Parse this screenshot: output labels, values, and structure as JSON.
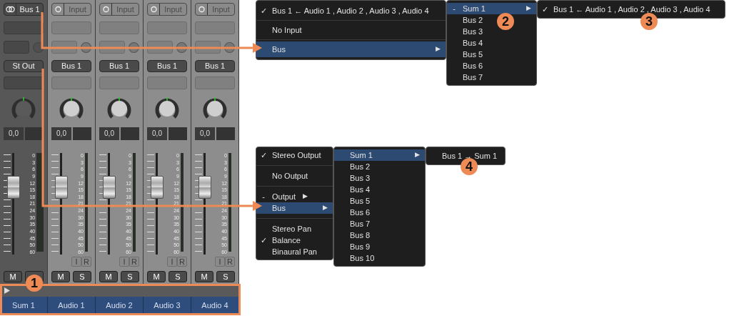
{
  "strips": [
    {
      "kind": "aux",
      "input": {
        "kind": "stereo",
        "label": "Bus 1",
        "assigned": true
      },
      "output": "St Out",
      "pan": "0,0",
      "level": 0.7,
      "scale": [
        "0",
        "3",
        "6",
        "9",
        "12",
        "15",
        "18",
        "21",
        "24",
        "30",
        "35",
        "40",
        "45",
        "50",
        "60"
      ],
      "mute": "M",
      "name": "Sum 1"
    },
    {
      "kind": "audio",
      "input": {
        "kind": "mono",
        "label": "Input",
        "assigned": false
      },
      "output": "Bus 1",
      "pan": "0,0",
      "level": 0.7,
      "scale": [
        "0",
        "3",
        "6",
        "9",
        "12",
        "15",
        "18",
        "21",
        "24",
        "30",
        "35",
        "40",
        "45",
        "50",
        "60"
      ],
      "ir": [
        "I",
        "R"
      ],
      "mute": "M",
      "solo": "S",
      "name": "Audio 1"
    },
    {
      "kind": "audio",
      "input": {
        "kind": "mono",
        "label": "Input",
        "assigned": false
      },
      "output": "Bus 1",
      "pan": "0,0",
      "level": 0.7,
      "scale": [
        "0",
        "3",
        "6",
        "9",
        "12",
        "15",
        "18",
        "21",
        "24",
        "30",
        "35",
        "40",
        "45",
        "50",
        "60"
      ],
      "ir": [
        "I",
        "R"
      ],
      "mute": "M",
      "solo": "S",
      "name": "Audio 2"
    },
    {
      "kind": "audio",
      "input": {
        "kind": "mono",
        "label": "Input",
        "assigned": false
      },
      "output": "Bus 1",
      "pan": "0,0",
      "level": 0.7,
      "scale": [
        "0",
        "3",
        "6",
        "9",
        "12",
        "15",
        "18",
        "21",
        "24",
        "30",
        "35",
        "40",
        "45",
        "50",
        "60"
      ],
      "ir": [
        "I",
        "R"
      ],
      "mute": "M",
      "solo": "S",
      "name": "Audio 3"
    },
    {
      "kind": "audio",
      "input": {
        "kind": "mono",
        "label": "Input",
        "assigned": false
      },
      "output": "Bus 1",
      "pan": "0,0",
      "level": 0.7,
      "scale": [
        "0",
        "3",
        "6",
        "9",
        "12",
        "15",
        "18",
        "21",
        "24",
        "30",
        "35",
        "40",
        "45",
        "50",
        "60"
      ],
      "ir": [
        "I",
        "R"
      ],
      "mute": "M",
      "solo": "S",
      "name": "Audio 4"
    }
  ],
  "menus": [
    {
      "items": [
        {
          "kind": "item",
          "mark": "✓",
          "label": "Bus 1 ← Audio 1 , Audio 2 , Audio 3 , Audio 4",
          "selected": false
        },
        {
          "kind": "separator"
        },
        {
          "kind": "item",
          "label": "No Input",
          "selected": false
        },
        {
          "kind": "separator"
        },
        {
          "kind": "item",
          "label": "Bus",
          "arrow": "▶",
          "selected": true
        }
      ]
    },
    {
      "items": [
        {
          "kind": "item",
          "mark": "-",
          "label": "Sum 1",
          "arrow": "▶",
          "selected": true
        },
        {
          "kind": "item",
          "label": "Bus 2",
          "selected": false
        },
        {
          "kind": "item",
          "label": "Bus 3",
          "selected": false
        },
        {
          "kind": "item",
          "label": "Bus 4",
          "selected": false
        },
        {
          "kind": "item",
          "label": "Bus 5",
          "selected": false
        },
        {
          "kind": "item",
          "label": "Bus 6",
          "selected": false
        },
        {
          "kind": "item",
          "label": "Bus 7",
          "selected": false
        }
      ]
    },
    {
      "items": [
        {
          "kind": "item",
          "mark": "✓",
          "label": "Bus 1 ← Audio 1 , Audio 2 , Audio 3 , Audio 4",
          "selected": false
        }
      ]
    },
    {
      "items": [
        {
          "kind": "item",
          "mark": "✓",
          "label": "Stereo Output",
          "selected": false
        },
        {
          "kind": "separator"
        },
        {
          "kind": "item",
          "label": "No Output",
          "selected": false
        },
        {
          "kind": "separator"
        },
        {
          "kind": "item",
          "mark": "-",
          "label": "Output",
          "arrow": "▶",
          "selected": false
        },
        {
          "kind": "item",
          "label": "Bus",
          "arrow": "▶",
          "selected": true
        },
        {
          "kind": "separator"
        },
        {
          "kind": "item",
          "label": "Stereo Pan",
          "selected": false
        },
        {
          "kind": "item",
          "mark": "✓",
          "label": "Balance",
          "selected": false
        },
        {
          "kind": "item",
          "label": "Binaural Pan",
          "selected": false
        }
      ]
    },
    {
      "items": [
        {
          "kind": "item",
          "label": "Sum 1",
          "arrow": "▶",
          "selected": true
        },
        {
          "kind": "item",
          "label": "Bus 2",
          "selected": false
        },
        {
          "kind": "item",
          "label": "Bus 3",
          "selected": false
        },
        {
          "kind": "item",
          "label": "Bus 4",
          "selected": false
        },
        {
          "kind": "item",
          "label": "Bus 5",
          "selected": false
        },
        {
          "kind": "item",
          "label": "Bus 6",
          "selected": false
        },
        {
          "kind": "item",
          "label": "Bus 7",
          "selected": false
        },
        {
          "kind": "item",
          "label": "Bus 8",
          "selected": false
        },
        {
          "kind": "item",
          "label": "Bus 9",
          "selected": false
        },
        {
          "kind": "item",
          "label": "Bus 10",
          "selected": false
        }
      ]
    },
    {
      "items": [
        {
          "kind": "item",
          "label": "Bus 1 → Sum 1",
          "selected": false
        }
      ]
    }
  ],
  "callouts": [
    {
      "label": "1"
    },
    {
      "label": "2"
    },
    {
      "label": "3"
    },
    {
      "label": "4"
    }
  ]
}
